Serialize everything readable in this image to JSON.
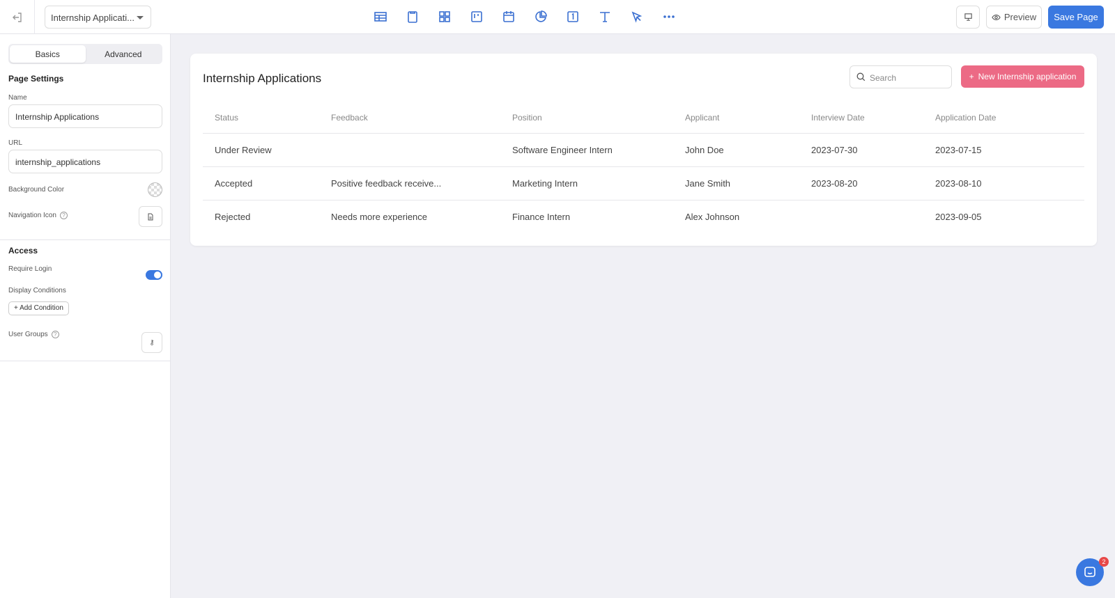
{
  "topbar": {
    "page_selector": "Internship Applicati...",
    "preview": "Preview",
    "save": "Save Page",
    "tools": [
      "table-icon",
      "clipboard-icon",
      "grid-icon",
      "kanban-icon",
      "calendar-icon",
      "pie-chart-icon",
      "number-icon",
      "text-icon",
      "pointer-icon",
      "more-icon"
    ]
  },
  "sidebar": {
    "tabs": [
      "Basics",
      "Advanced"
    ],
    "page_settings": "Page Settings",
    "name_label": "Name",
    "name_value": "Internship Applications",
    "url_label": "URL",
    "url_value": "internship_applications",
    "bg_color": "Background Color",
    "nav_icon": "Navigation Icon",
    "access": "Access",
    "require_login": "Require Login",
    "require_login_on": true,
    "display_conditions": "Display Conditions",
    "add_condition": "Add Condition",
    "user_groups": "User Groups"
  },
  "main": {
    "title": "Internship Applications",
    "search_placeholder": "Search",
    "new_button": "New Internship application",
    "columns": [
      "Status",
      "Feedback",
      "Position",
      "Applicant",
      "Interview Date",
      "Application Date"
    ],
    "rows": [
      [
        "Under Review",
        "",
        "Software Engineer Intern",
        "John Doe",
        "2023-07-30",
        "2023-07-15"
      ],
      [
        "Accepted",
        "Positive feedback receive...",
        "Marketing Intern",
        "Jane Smith",
        "2023-08-20",
        "2023-08-10"
      ],
      [
        "Rejected",
        "Needs more experience",
        "Finance Intern",
        "Alex Johnson",
        "",
        "2023-09-05"
      ]
    ]
  },
  "chat": {
    "badge": "2"
  },
  "colors": {
    "primary": "#3a78e0",
    "new_button": "#ec6a85"
  }
}
